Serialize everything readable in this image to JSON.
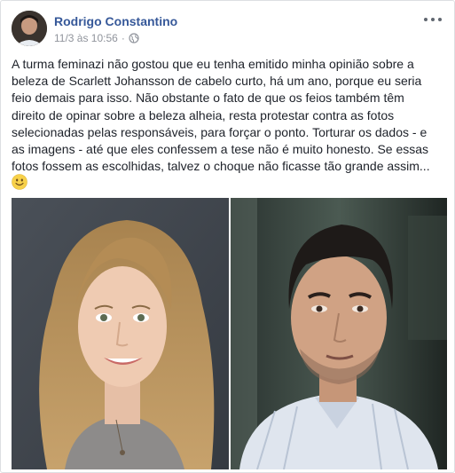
{
  "post": {
    "author_name": "Rodrigo Constantino",
    "timestamp": "11/3 às 10:56",
    "separator": "·",
    "privacy_icon": "globe-icon",
    "more_icon": "more-options-icon",
    "text_lines": [
      "A turma feminazi não gostou que eu tenha emitido minha opinião sobre a",
      "beleza de Scarlett Johansson de cabelo curto, há um ano, porque eu seria",
      "feio demais para isso. Não obstante o fato de que os feios também têm",
      "direito de opinar sobre a beleza alheia, resta protestar contra as fotos",
      "selecionadas pelas responsáveis, para forçar o ponto. Torturar os dados - e",
      "as imagens - até que eles confessem a tese não é muito honesto. Se essas",
      "fotos fossem as escolhidas, talvez o choque não ficasse tão grande assim..."
    ],
    "emoji": "smiley-emoji-icon"
  },
  "colors": {
    "author_link": "#365899",
    "meta_gray": "#90949c",
    "body_text": "#1d2129"
  }
}
